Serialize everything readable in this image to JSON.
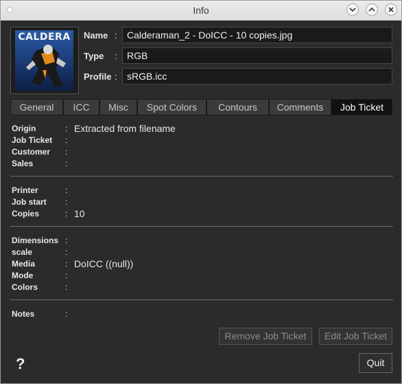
{
  "window": {
    "title": "Info"
  },
  "thumbnail": {
    "title_text": "CALDERA"
  },
  "fields": {
    "name_label": "Name",
    "name_value": "Calderaman_2 - DoICC - 10 copies.jpg",
    "type_label": "Type",
    "type_value": "RGB",
    "profile_label": "Profile",
    "profile_value": "sRGB.icc",
    "colon": ":"
  },
  "tabs": [
    {
      "label": "General"
    },
    {
      "label": "ICC"
    },
    {
      "label": "Misc"
    },
    {
      "label": "Spot Colors"
    },
    {
      "label": "Contours"
    },
    {
      "label": "Comments"
    },
    {
      "label": "Job Ticket",
      "active": true
    }
  ],
  "job_ticket": {
    "colon": ":",
    "origin_label": "Origin",
    "origin_value": "Extracted from filename",
    "job_ticket_label": "Job Ticket",
    "customer_label": "Customer",
    "sales_label": "Sales",
    "printer_label": "Printer",
    "job_start_label": "Job start",
    "copies_label": "Copies",
    "copies_value": "10",
    "dimensions_label": "Dimensions",
    "scale_label": "scale",
    "media_label": "Media",
    "media_value": "DoICC ((null))",
    "mode_label": "Mode",
    "colors_label": "Colors",
    "notes_label": "Notes"
  },
  "buttons": {
    "remove": "Remove Job Ticket",
    "edit": "Edit Job Ticket",
    "quit": "Quit",
    "help": "?"
  }
}
